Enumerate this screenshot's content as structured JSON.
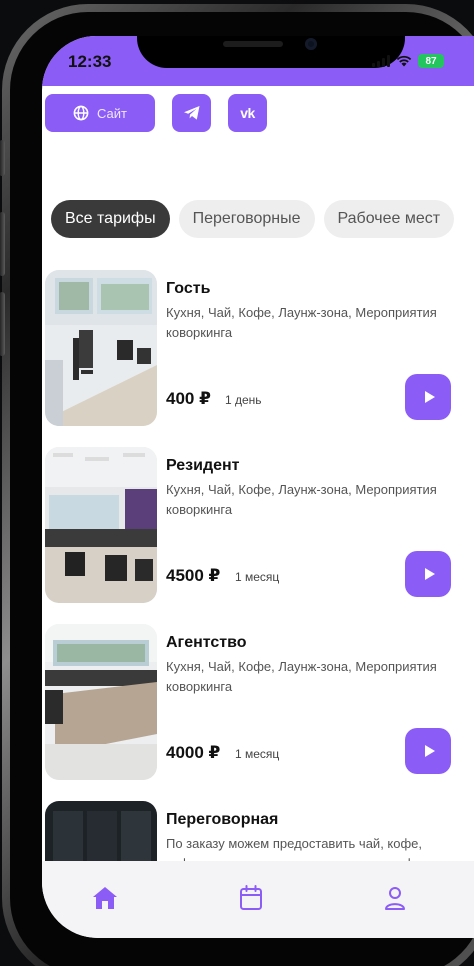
{
  "status": {
    "time": "12:33",
    "battery": "87"
  },
  "social": {
    "site_label": "Сайт",
    "icons": [
      "globe-icon",
      "telegram-icon",
      "vk-icon"
    ],
    "vk_label": "vk"
  },
  "filters": [
    {
      "label": "Все тарифы",
      "active": true
    },
    {
      "label": "Переговорные",
      "active": false
    },
    {
      "label": "Рабочее мест",
      "active": false
    }
  ],
  "tariffs": [
    {
      "title": "Гость",
      "desc": "Кухня, Чай, Кофе, Лаунж-зона, Мероприятия коворкинга",
      "price": "400 ₽",
      "period": "1 день"
    },
    {
      "title": "Резидент",
      "desc": "Кухня, Чай, Кофе, Лаунж-зона, Мероприятия коворкинга",
      "price": "4500 ₽",
      "period": "1 месяц"
    },
    {
      "title": "Агентство",
      "desc": "Кухня, Чай, Кофе, Лаунж-зона, Мероприятия коворкинга",
      "price": "4000 ₽",
      "period": "1 месяц"
    },
    {
      "title": "Переговорная",
      "desc": "По заказу можем предоставить чай, кофе, кофемашину, кухню для проведения кофе-брейков, кейтеринг"
    }
  ],
  "nav": {
    "icons": [
      "home-icon",
      "calendar-icon",
      "profile-icon"
    ],
    "active": "home"
  },
  "colors": {
    "accent": "#8b5cf6",
    "chip_active": "#3a3a3a",
    "nav_bg": "#f4f3f6",
    "battery": "#22c55e"
  }
}
